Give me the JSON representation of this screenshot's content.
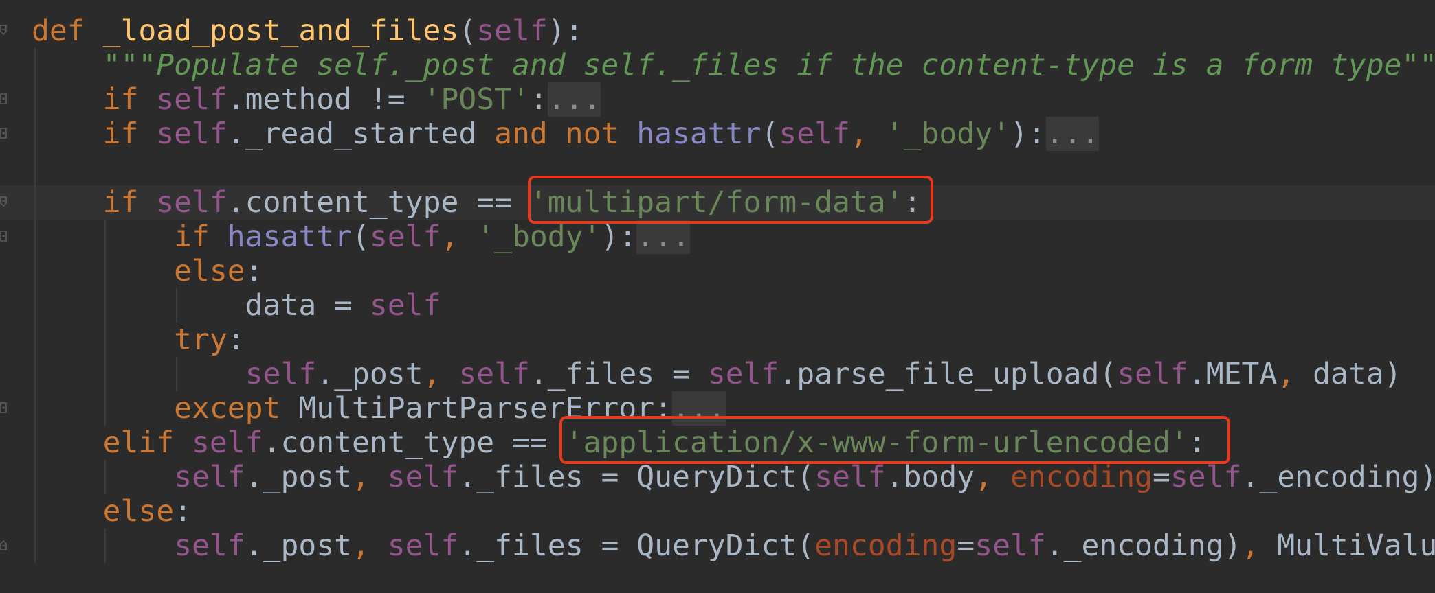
{
  "editor": {
    "lines": [
      {
        "id": "l1",
        "tokens": [
          [
            "kw",
            "def "
          ],
          [
            "fn",
            "_load_post_and_files"
          ],
          [
            "plain",
            "("
          ],
          [
            "self",
            "self"
          ],
          [
            "plain",
            "):"
          ]
        ]
      },
      {
        "id": "l2",
        "tokens": [
          [
            "plain",
            "    "
          ],
          [
            "doc",
            "\"\"\"Populate self._post and self._files if the content-type is a form type\"\"\""
          ]
        ]
      },
      {
        "id": "l3",
        "tokens": [
          [
            "plain",
            "    "
          ],
          [
            "kw",
            "if "
          ],
          [
            "self",
            "self"
          ],
          [
            "plain",
            ".method != "
          ],
          [
            "str",
            "'POST'"
          ],
          [
            "plain",
            ":"
          ],
          [
            "folded",
            "..."
          ]
        ]
      },
      {
        "id": "l4",
        "tokens": [
          [
            "plain",
            "    "
          ],
          [
            "kw",
            "if "
          ],
          [
            "self",
            "self"
          ],
          [
            "plain",
            "._read_started "
          ],
          [
            "kw",
            "and not "
          ],
          [
            "bi",
            "hasattr"
          ],
          [
            "plain",
            "("
          ],
          [
            "self",
            "self"
          ],
          [
            "kw",
            ", "
          ],
          [
            "str",
            "'_body'"
          ],
          [
            "plain",
            "):"
          ],
          [
            "folded",
            "..."
          ]
        ]
      },
      {
        "id": "l5",
        "tokens": []
      },
      {
        "id": "l6",
        "tokens": [
          [
            "plain",
            "    "
          ],
          [
            "kw",
            "if "
          ],
          [
            "self",
            "self"
          ],
          [
            "plain",
            ".content_type == "
          ],
          [
            "str",
            "'multipart/form-data'"
          ],
          [
            "plain",
            ":"
          ]
        ]
      },
      {
        "id": "l7",
        "tokens": [
          [
            "plain",
            "        "
          ],
          [
            "kw",
            "if "
          ],
          [
            "bi",
            "hasattr"
          ],
          [
            "plain",
            "("
          ],
          [
            "self",
            "self"
          ],
          [
            "kw",
            ", "
          ],
          [
            "str",
            "'_body'"
          ],
          [
            "plain",
            "):"
          ],
          [
            "folded",
            "..."
          ]
        ]
      },
      {
        "id": "l8",
        "tokens": [
          [
            "plain",
            "        "
          ],
          [
            "kw",
            "else"
          ],
          [
            "plain",
            ":"
          ]
        ]
      },
      {
        "id": "l9",
        "tokens": [
          [
            "plain",
            "            data = "
          ],
          [
            "self",
            "self"
          ]
        ]
      },
      {
        "id": "l10",
        "tokens": [
          [
            "plain",
            "        "
          ],
          [
            "kw",
            "try"
          ],
          [
            "plain",
            ":"
          ]
        ]
      },
      {
        "id": "l11",
        "tokens": [
          [
            "plain",
            "            "
          ],
          [
            "self",
            "self"
          ],
          [
            "plain",
            "._post"
          ],
          [
            "kw",
            ", "
          ],
          [
            "self",
            "self"
          ],
          [
            "plain",
            "._files = "
          ],
          [
            "self",
            "self"
          ],
          [
            "plain",
            ".parse_file_upload("
          ],
          [
            "self",
            "self"
          ],
          [
            "plain",
            ".META"
          ],
          [
            "kw",
            ", "
          ],
          [
            "plain",
            "data)"
          ]
        ]
      },
      {
        "id": "l12",
        "tokens": [
          [
            "plain",
            "        "
          ],
          [
            "kw",
            "except "
          ],
          [
            "plain",
            "MultiPartParserError:"
          ],
          [
            "folded",
            "..."
          ]
        ]
      },
      {
        "id": "l13",
        "tokens": [
          [
            "plain",
            "    "
          ],
          [
            "kw",
            "elif "
          ],
          [
            "self",
            "self"
          ],
          [
            "plain",
            ".content_type == "
          ],
          [
            "str",
            "'application/x-www-form-urlencoded'"
          ],
          [
            "plain",
            ":"
          ]
        ]
      },
      {
        "id": "l14",
        "tokens": [
          [
            "plain",
            "        "
          ],
          [
            "self",
            "self"
          ],
          [
            "plain",
            "._post"
          ],
          [
            "kw",
            ", "
          ],
          [
            "self",
            "self"
          ],
          [
            "plain",
            "._files = QueryDict("
          ],
          [
            "self",
            "self"
          ],
          [
            "plain",
            ".body"
          ],
          [
            "kw",
            ", "
          ],
          [
            "param",
            "encoding"
          ],
          [
            "plain",
            "="
          ],
          [
            "self",
            "self"
          ],
          [
            "plain",
            "._encoding)"
          ]
        ]
      },
      {
        "id": "l15",
        "tokens": [
          [
            "plain",
            "    "
          ],
          [
            "kw",
            "else"
          ],
          [
            "plain",
            ":"
          ]
        ]
      },
      {
        "id": "l16",
        "tokens": [
          [
            "plain",
            "        "
          ],
          [
            "self",
            "self"
          ],
          [
            "plain",
            "._post"
          ],
          [
            "kw",
            ", "
          ],
          [
            "self",
            "self"
          ],
          [
            "plain",
            "._files = QueryDict("
          ],
          [
            "param",
            "encoding"
          ],
          [
            "plain",
            "="
          ],
          [
            "self",
            "self"
          ],
          [
            "plain",
            "._encoding)"
          ],
          [
            "kw",
            ", "
          ],
          [
            "plain",
            "MultiValu"
          ]
        ]
      }
    ]
  },
  "colors": {
    "background": "#2b2b2b",
    "keyword": "#cc7832",
    "function": "#ffc66d",
    "self": "#94558d",
    "string": "#6a8759",
    "docstring": "#629755",
    "builtin": "#8888c6",
    "param": "#aa4926",
    "highlight_box": "#e8391e"
  }
}
